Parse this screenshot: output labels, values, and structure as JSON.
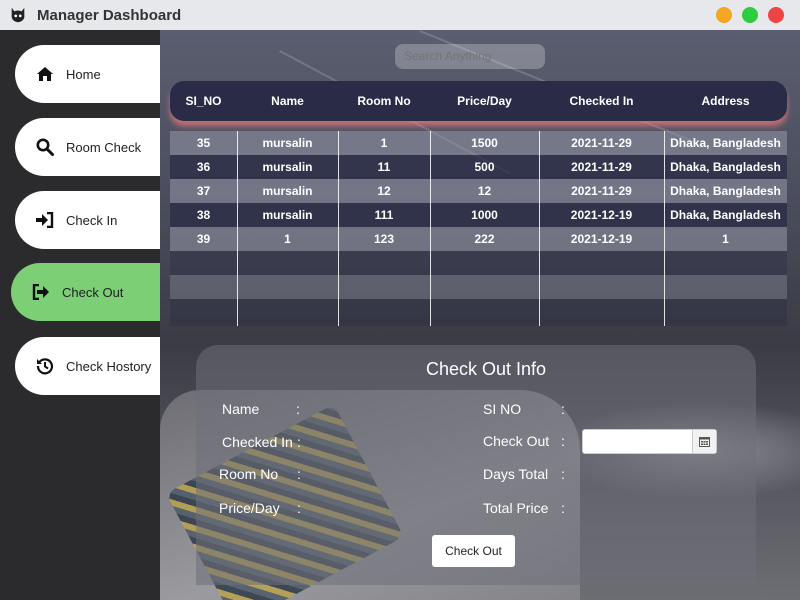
{
  "window": {
    "title": "Manager Dashboard"
  },
  "sidebar": {
    "items": [
      {
        "label": "Home",
        "icon": "home-icon",
        "active": false
      },
      {
        "label": "Room Check",
        "icon": "search-icon",
        "active": false
      },
      {
        "label": "Check In",
        "icon": "sign-in-icon",
        "active": false
      },
      {
        "label": "Check Out",
        "icon": "sign-out-icon",
        "active": true
      },
      {
        "label": "Check Hostory",
        "icon": "history-icon",
        "active": false
      }
    ],
    "active_color": "#7ccf75"
  },
  "search": {
    "placeholder": "Search Anything"
  },
  "table": {
    "columns": [
      "SI_NO",
      "Name",
      "Room No",
      "Price/Day",
      "Checked In",
      "Address"
    ],
    "rows": [
      [
        "35",
        "mursalin",
        "1",
        "1500",
        "2021-11-29",
        "Dhaka, Bangladesh"
      ],
      [
        "36",
        "mursalin",
        "11",
        "500",
        "2021-11-29",
        "Dhaka, Bangladesh"
      ],
      [
        "37",
        "mursalin",
        "12",
        "12",
        "2021-11-29",
        "Dhaka, Bangladesh"
      ],
      [
        "38",
        "mursalin",
        "111",
        "1000",
        "2021-12-19",
        "Dhaka, Bangladesh"
      ],
      [
        "39",
        "1",
        "123",
        "222",
        "2021-12-19",
        "1"
      ]
    ]
  },
  "checkout": {
    "title": "Check Out Info",
    "fields": {
      "name": "Name",
      "checked_in": "Checked In",
      "room_no": "Room No",
      "price_day": "Price/Day",
      "si_no": "SI NO",
      "check_out": "Check Out",
      "days_total": "Days Total",
      "total_price": "Total Price"
    },
    "colon": ":",
    "button_label": "Check Out"
  }
}
